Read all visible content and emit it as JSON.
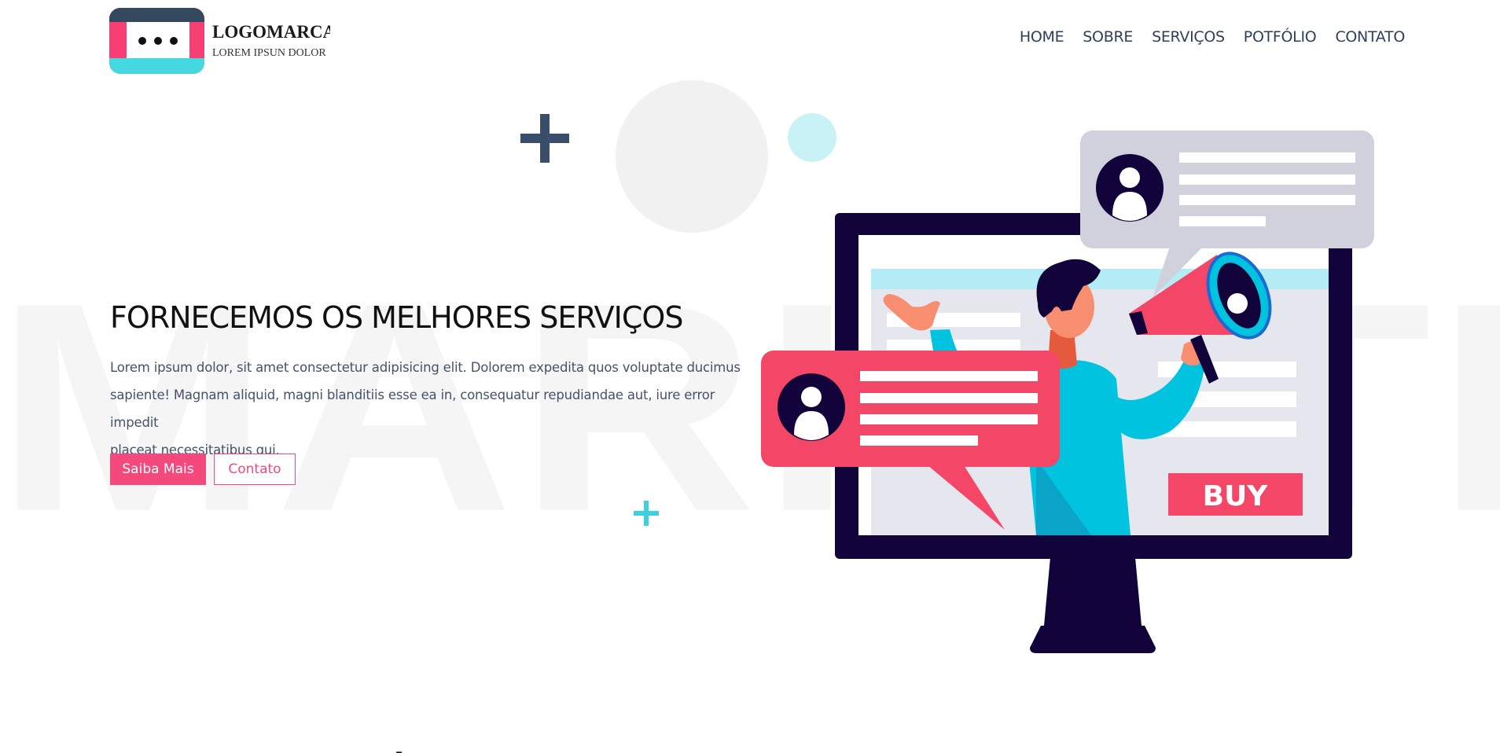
{
  "background_word": "MARKETING",
  "logo": {
    "title": "LOGOMARCA",
    "subtitle": "LOREM IPSUN DOLOR",
    "colors": {
      "pink": "#f73f73",
      "navy": "#34495e",
      "cyan": "#45d8e0"
    }
  },
  "nav": {
    "items": [
      {
        "label": "HOME"
      },
      {
        "label": "SOBRE"
      },
      {
        "label": "SERVIÇOS"
      },
      {
        "label": "POTFÓLIO"
      },
      {
        "label": "CONTATO"
      }
    ]
  },
  "hero": {
    "title": "FORNECEMOS OS MELHORES SERVIÇOS",
    "text_lines": [
      "Lorem ipsum dolor, sit amet consectetur adipisicing elit. Dolorem expedita quos voluptate ducimus",
      "sapiente! Magnam aliquid, magni blanditiis esse ea in, consequatur repudiandae aut, iure error impedit",
      "placeat necessitatibus qui."
    ],
    "primary_button": "Saiba Mais",
    "secondary_button": "Contato"
  },
  "illustration": {
    "buy_label": "BUY",
    "icons": [
      "monitor-icon",
      "megaphone-icon",
      "person-icon",
      "chat-bubble-icon",
      "user-avatar-icon"
    ]
  },
  "next_section": {
    "partial_heading": "·"
  },
  "colors": {
    "accent_pink": "#f4497c",
    "nav_text": "#2e3f5a",
    "body_text": "#44526a",
    "monitor_dark": "#12033a",
    "shirt_cyan": "#00c3e0"
  }
}
